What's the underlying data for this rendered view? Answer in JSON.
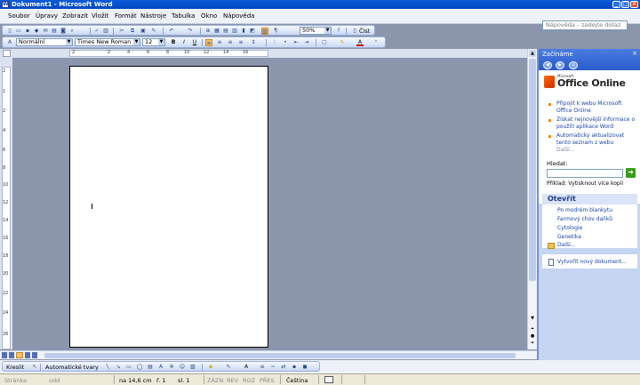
{
  "window": {
    "title": "Dokument1 - Microsoft Word"
  },
  "menubar": {
    "items": [
      "Soubor",
      "Úpravy",
      "Zobrazit",
      "Vložit",
      "Formát",
      "Nástroje",
      "Tabulka",
      "Okno",
      "Nápověda"
    ],
    "help_placeholder": "Nápověda – zadejte dotaz"
  },
  "standard_toolbar": {
    "zoom": "50%",
    "read_label": "Číst"
  },
  "format_toolbar": {
    "style": "Normální",
    "font": "Times New Roman",
    "size": "12",
    "bold": "B",
    "italic": "I",
    "underline": "U"
  },
  "ruler": {
    "h_ticks": [
      "2",
      "2",
      "4",
      "6",
      "8",
      "10",
      "12",
      "14",
      "16"
    ],
    "v_ticks": [
      "2",
      "1",
      "2",
      "4",
      "6",
      "8",
      "10",
      "12",
      "14",
      "16",
      "18",
      "20",
      "22",
      "24",
      "26"
    ]
  },
  "task_pane": {
    "title": "Začínáme",
    "close": "×",
    "logo_small": "Microsoft",
    "logo_main": "Office Online",
    "links": [
      "Připojit k webu Microsoft Office Online",
      "Získat nejnovější informace o použití aplikace Word",
      "Automaticky aktualizovat tento seznam z webu"
    ],
    "more": "Další...",
    "search_label": "Hledat:",
    "example": "Příklad: Vytisknout více kopií",
    "open_title": "Otevřít",
    "files": [
      "Po modrém blankytu",
      "Farmový chov daňků",
      "Cytologie",
      "Genetika"
    ],
    "files_more": "Další...",
    "new_doc": "Vytvořit nový dokument..."
  },
  "drawing_toolbar": {
    "draw": "Kreslit",
    "autoshapes": "Automatické tvary"
  },
  "statusbar": {
    "page": "Stránka",
    "section": "odd",
    "position": "na 14,6 cm",
    "line": "ř. 1",
    "column": "sl. 1",
    "rec": "ZÁZN",
    "trk": "REV",
    "ext": "ROZ",
    "ovr": "PŘES",
    "language": "Čeština"
  }
}
